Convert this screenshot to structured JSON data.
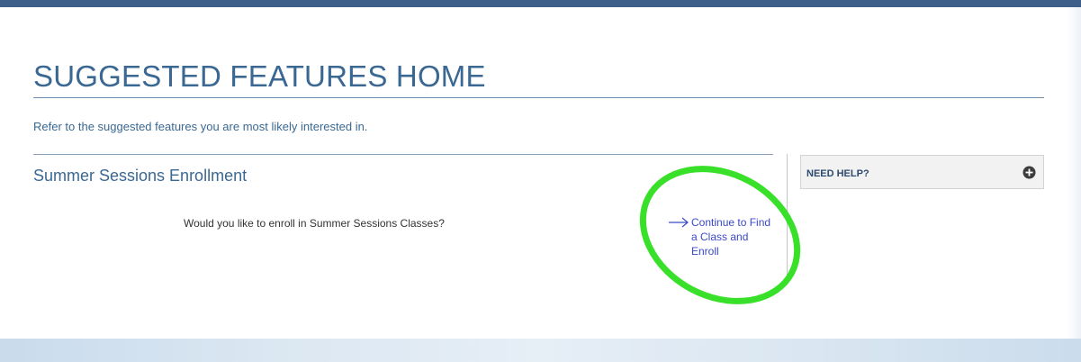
{
  "page": {
    "title": "SUGGESTED FEATURES HOME",
    "subtitle": "Refer to the suggested features you are most likely interested in."
  },
  "section": {
    "title": "Summer Sessions Enrollment",
    "question": "Would you like to enroll in Summer Sessions Classes?",
    "continue_link_label": "Continue to Find a Class and Enroll",
    "link_icon": "right-arrow-icon"
  },
  "help": {
    "label": "NEED HELP?",
    "icon": "plus-circle-icon"
  },
  "annotation": {
    "highlight_color": "#39e02a"
  },
  "colors": {
    "heading": "#3a6893",
    "link": "#3a49c9",
    "top_bar": "#3e5f8a"
  }
}
